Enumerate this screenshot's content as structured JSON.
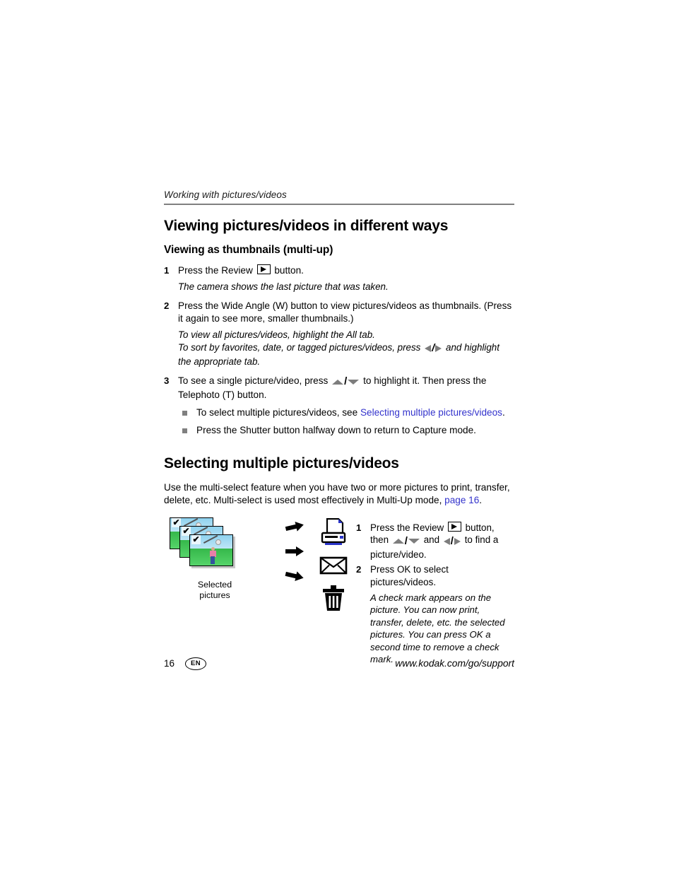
{
  "running_header": "Working with pictures/videos",
  "section1": {
    "title": "Viewing pictures/videos in different ways",
    "subtitle": "Viewing as thumbnails (multi-up)",
    "steps": [
      {
        "num": "1",
        "text_before": "Press the Review",
        "text_after": "button.",
        "note": "The camera shows the last picture that was taken."
      },
      {
        "num": "2",
        "text": "Press the Wide Angle (W) button to view pictures/videos as thumbnails. (Press it again to see more, smaller thumbnails.)",
        "note_line1": "To view all pictures/videos, highlight the All tab.",
        "note_line2_before": "To sort by favorites, date, or tagged pictures/videos, press",
        "note_line2_after": "and highlight the appropriate tab."
      },
      {
        "num": "3",
        "text_before": "To see a single picture/video, press",
        "text_after": "to highlight it. Then press the Telephoto (T) button."
      }
    ],
    "bullets": [
      {
        "text_before": "To select multiple pictures/videos, see",
        "link": "Selecting multiple pictures/videos",
        "text_after": "."
      },
      {
        "text_before": "Press the Shutter button halfway down to return to Capture mode.",
        "link": "",
        "text_after": ""
      }
    ]
  },
  "section2": {
    "title": "Selecting multiple pictures/videos",
    "intro_before": "Use the multi-select feature when you have two or more pictures to print, transfer, delete, etc. Multi-select is used most effectively in Multi-Up mode,",
    "intro_link": "page 16",
    "intro_after": ".",
    "figure": {
      "caption_line1": "Selected",
      "caption_line2": "pictures",
      "icons": [
        "printer-icon",
        "envelope-icon",
        "trash-icon"
      ],
      "photo_count": 3,
      "check_glyph": "✔"
    },
    "steps": [
      {
        "num": "1",
        "text_before": "Press the Review",
        "text_mid": "button, then",
        "text_and": "and",
        "text_after": "to find a picture/video."
      },
      {
        "num": "2",
        "text": "Press OK to select pictures/videos.",
        "note": "A check mark appears on the picture. You can now print, transfer, delete, etc. the selected pictures. You can press OK a second time to remove a check mark."
      }
    ]
  },
  "footer": {
    "page_number": "16",
    "language_badge": "EN",
    "website": "www.kodak.com/go/support"
  },
  "colors": {
    "link": "#3333cc",
    "rule": "#808080",
    "bullet": "#808080"
  }
}
